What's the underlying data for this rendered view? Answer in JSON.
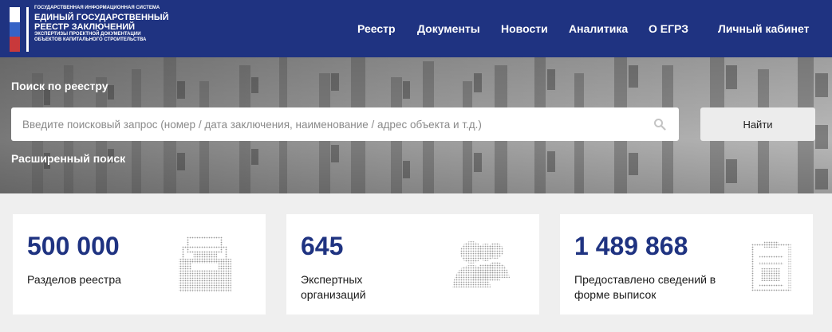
{
  "header": {
    "logo": {
      "line_small_1": "ГОСУДАРСТВЕННАЯ ИНФОРМАЦИОННАЯ СИСТЕМА",
      "line_big_1": "ЕДИНЫЙ ГОСУДАРСТВЕННЫЙ",
      "line_big_2": "РЕЕСТР ЗАКЛЮЧЕНИЙ",
      "line_small_2": "ЭКСПЕРТИЗЫ ПРОЕКТНОЙ ДОКУМЕНТАЦИИ",
      "line_small_3": "ОБЪЕКТОВ КАПИТАЛЬНОГО СТРОИТЕЛЬСТВА"
    },
    "nav": [
      "Реестр",
      "Документы",
      "Новости",
      "Аналитика",
      "О ЕГРЗ",
      "Личный кабинет"
    ],
    "colors": {
      "bar": "#1f3381",
      "flag_white": "#ffffff",
      "flag_blue": "#3563c6",
      "flag_red": "#c8393b"
    }
  },
  "hero": {
    "title": "Поиск по реестру",
    "search_placeholder": "Введите поисковый запрос (номер / дата заключения, наименование / адрес объекта и т.д.)",
    "search_icon": "search-icon",
    "find_button": "Найти",
    "advanced_link": "Расширенный поиск"
  },
  "stats": [
    {
      "value": "500 000",
      "label": "Разделов реестра",
      "icon": "archive-box-icon"
    },
    {
      "value": "645",
      "label_line1": "Экспертных",
      "label_line2": "организаций",
      "icon": "people-group-icon"
    },
    {
      "value": "1 489 868",
      "label_line1": "Предоставлено сведений в",
      "label_line2": "форме выписок",
      "icon": "clipboard-document-icon"
    }
  ],
  "accent_color": "#1f3381"
}
